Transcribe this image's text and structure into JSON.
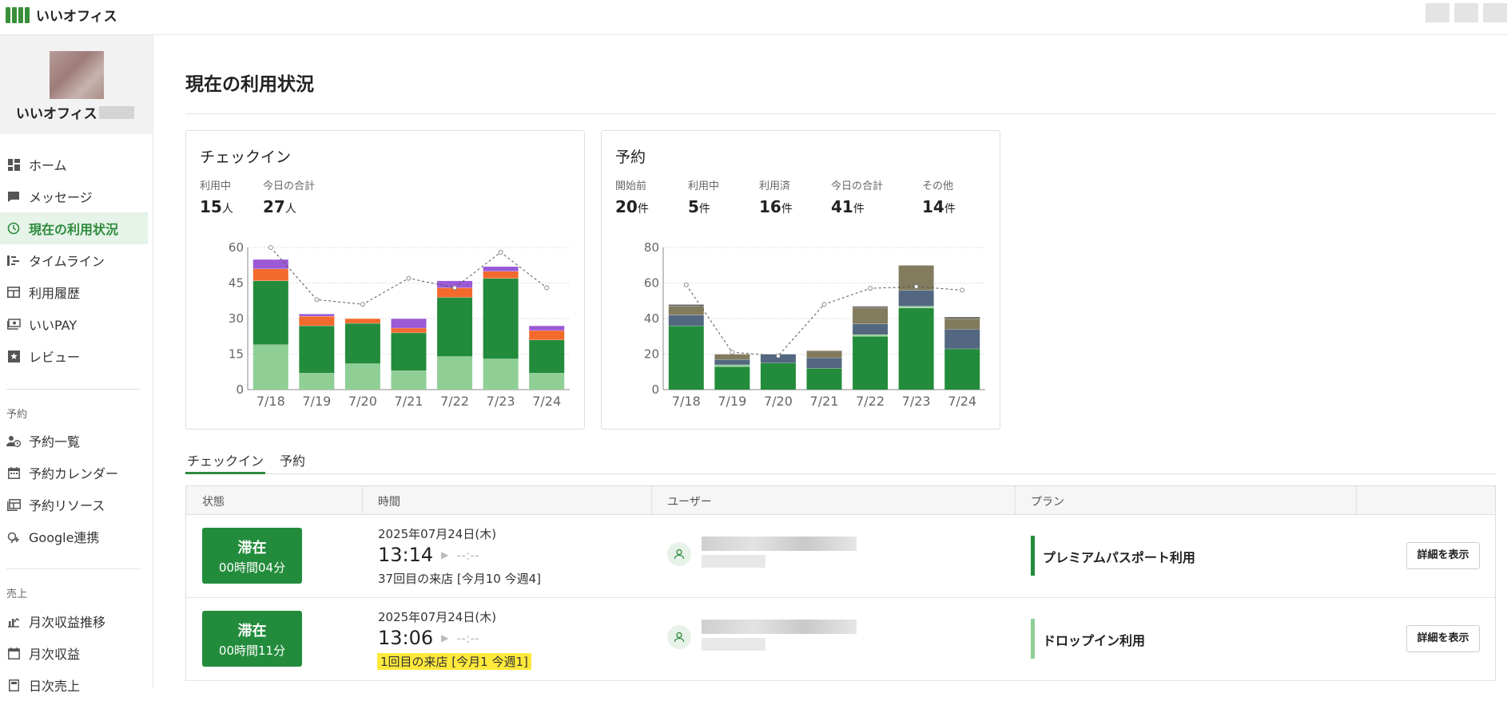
{
  "app": {
    "name": "いいオフィス"
  },
  "org": {
    "name": "いいオフィス"
  },
  "sidebar": {
    "items": [
      {
        "label": "ホーム",
        "icon": "dashboard-icon"
      },
      {
        "label": "メッセージ",
        "icon": "message-icon"
      },
      {
        "label": "現在の利用状況",
        "icon": "clock-icon",
        "active": true
      },
      {
        "label": "タイムライン",
        "icon": "timeline-icon"
      },
      {
        "label": "利用履歴",
        "icon": "table-icon"
      },
      {
        "label": "いいPAY",
        "icon": "payment-icon"
      },
      {
        "label": "レビュー",
        "icon": "star-icon"
      }
    ],
    "reservation_section": "予約",
    "reservation_items": [
      {
        "label": "予約一覧",
        "icon": "person-clock-icon"
      },
      {
        "label": "予約カレンダー",
        "icon": "calendar-icon"
      },
      {
        "label": "予約リソース",
        "icon": "resource-icon"
      },
      {
        "label": "Google連携",
        "icon": "link-icon"
      }
    ],
    "sales_section": "売上",
    "sales_items": [
      {
        "label": "月次収益推移",
        "icon": "chart-icon"
      },
      {
        "label": "月次収益",
        "icon": "calendar-icon"
      },
      {
        "label": "日次売上",
        "icon": "calculator-icon"
      }
    ]
  },
  "page": {
    "title": "現在の利用状況"
  },
  "checkin_card": {
    "title": "チェックイン",
    "stats": [
      {
        "label": "利用中",
        "value": "15",
        "unit": "人"
      },
      {
        "label": "今日の合計",
        "value": "27",
        "unit": "人"
      }
    ]
  },
  "reservation_card": {
    "title": "予約",
    "stats": [
      {
        "label": "開始前",
        "value": "20",
        "unit": "件"
      },
      {
        "label": "利用中",
        "value": "5",
        "unit": "件"
      },
      {
        "label": "利用済",
        "value": "16",
        "unit": "件"
      },
      {
        "label": "今日の合計",
        "value": "41",
        "unit": "件"
      },
      {
        "label": "その他",
        "value": "14",
        "unit": "件"
      }
    ]
  },
  "chart_data": [
    {
      "type": "bar",
      "stacked": true,
      "categories": [
        "7/18",
        "7/19",
        "7/20",
        "7/21",
        "7/22",
        "7/23",
        "7/24"
      ],
      "ylim": [
        0,
        60
      ],
      "yticks": [
        0,
        15,
        30,
        45,
        60
      ],
      "grid": true,
      "colors": [
        "#8fcf95",
        "#238c3c",
        "#f36a2d",
        "#9b59d6"
      ],
      "series": [
        {
          "values": [
            19,
            7,
            11,
            8,
            14,
            13,
            7
          ]
        },
        {
          "values": [
            27,
            20,
            17,
            16,
            25,
            34,
            14
          ]
        },
        {
          "values": [
            5,
            4,
            2,
            2,
            4,
            3,
            4
          ]
        },
        {
          "values": [
            4,
            1,
            0,
            4,
            3,
            2,
            2
          ]
        }
      ],
      "line": {
        "values": [
          60,
          38,
          36,
          47,
          43,
          58,
          43
        ]
      }
    },
    {
      "type": "bar",
      "stacked": true,
      "categories": [
        "7/18",
        "7/19",
        "7/20",
        "7/21",
        "7/22",
        "7/23",
        "7/24"
      ],
      "ylim": [
        0,
        80
      ],
      "yticks": [
        0,
        20,
        40,
        60,
        80
      ],
      "grid": true,
      "colors": [
        "#238c3c",
        "#8fcf95",
        "#536880",
        "#837b5e",
        "#666666"
      ],
      "series": [
        {
          "values": [
            36,
            13,
            15,
            12,
            30,
            46,
            23
          ]
        },
        {
          "values": [
            0,
            1,
            0,
            0,
            1,
            1,
            0
          ]
        },
        {
          "values": [
            6,
            3,
            5,
            6,
            6,
            9,
            11
          ]
        },
        {
          "values": [
            5,
            3,
            0,
            4,
            9,
            14,
            6
          ]
        },
        {
          "values": [
            1,
            0,
            0,
            0,
            1,
            0,
            1
          ]
        }
      ],
      "line": {
        "values": [
          59,
          21,
          19,
          48,
          57,
          58,
          56
        ]
      }
    }
  ],
  "tabs": [
    "チェックイン",
    "予約"
  ],
  "table": {
    "headers": [
      "状態",
      "時間",
      "ユーザー",
      "プラン"
    ],
    "rows": [
      {
        "status": "滞在",
        "duration": "00時間04分",
        "date": "2025年07月24日(木)",
        "start": "13:14",
        "end": "--:--",
        "visit": "37回目の来店 [今月10 今週4]",
        "visit_highlight": false,
        "plan": "プレミアムパスポート利用",
        "plan_color": "#238c3c",
        "detail_label": "詳細を表示"
      },
      {
        "status": "滞在",
        "duration": "00時間11分",
        "date": "2025年07月24日(木)",
        "start": "13:06",
        "end": "--:--",
        "visit": "1回目の来店 [今月1 今週1]",
        "visit_highlight": true,
        "plan": "ドロップイン利用",
        "plan_color": "#8fcf95",
        "detail_label": "詳細を表示"
      }
    ]
  }
}
